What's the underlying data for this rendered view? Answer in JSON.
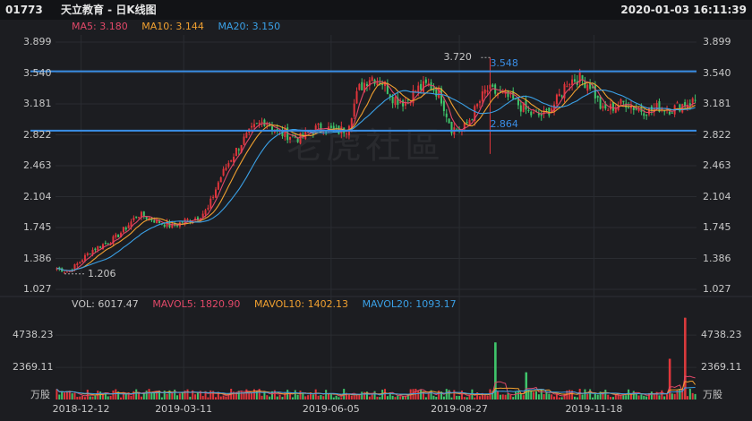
{
  "header": {
    "code": "01773",
    "name": "天立教育 - 日K线图",
    "datetime": "2020-01-03 16:11:39"
  },
  "ma_legend": {
    "ma5": "MA5: 3.180",
    "ma10": "MA10: 3.144",
    "ma20": "MA20: 3.150"
  },
  "vol_legend": {
    "vol": "VOL: 6017.47",
    "mavol5": "MAVOL5: 1820.90",
    "mavol10": "MAVOL10: 1402.13",
    "mavol20": "MAVOL20: 1093.17"
  },
  "watermark": "老虎社區",
  "colors": {
    "up": "#e0353b",
    "down": "#3fc56b",
    "ma5": "#e04868",
    "ma10": "#f0a030",
    "ma20": "#3aa0e6",
    "level_line": "#3a8ee6"
  },
  "chart_data": [
    {
      "type": "candlestick",
      "y_ticks": [
        "3.899",
        "3.540",
        "3.181",
        "2.822",
        "2.463",
        "2.104",
        "1.745",
        "1.386",
        "1.027"
      ],
      "ylim": [
        1.027,
        3.899
      ],
      "x_ticks": [
        "2018-12-12",
        "2019-03-11",
        "2019-06-05",
        "2019-08-27",
        "2019-11-18"
      ],
      "annotations": {
        "high_label": "3.720",
        "low_label": "1.206",
        "level_upper_label": "3.548",
        "level_lower_label": "2.864",
        "level_upper": 3.56,
        "level_lower": 2.87
      },
      "price_path": [
        1.27,
        1.23,
        1.35,
        1.48,
        1.55,
        1.62,
        1.75,
        1.9,
        1.85,
        1.8,
        1.76,
        1.82,
        1.86,
        1.95,
        2.3,
        2.55,
        2.75,
        2.9,
        3.0,
        2.85,
        2.82,
        2.78,
        2.88,
        2.92,
        2.85,
        2.9,
        3.35,
        3.5,
        3.45,
        3.25,
        3.2,
        3.35,
        3.4,
        3.3,
        2.9,
        2.88,
        3.1,
        3.35,
        3.3,
        3.25,
        3.15,
        3.05,
        3.05,
        3.2,
        3.45,
        3.48,
        3.4,
        3.1,
        3.15,
        3.2,
        3.12,
        3.1,
        3.15,
        3.12,
        3.18,
        3.22
      ]
    },
    {
      "type": "bar",
      "series": "volume",
      "y_ticks": [
        "4738.23",
        "2369.11"
      ],
      "unit": "万股",
      "ylim": [
        0,
        6200
      ],
      "last_value": 6017.47,
      "spikes": [
        {
          "position": 0.686,
          "value": 4200,
          "color": "down"
        },
        {
          "position": 0.735,
          "value": 2000,
          "color": "down"
        },
        {
          "position": 0.958,
          "value": 3000,
          "color": "up"
        },
        {
          "position": 0.985,
          "value": 6017,
          "color": "up"
        }
      ]
    }
  ]
}
